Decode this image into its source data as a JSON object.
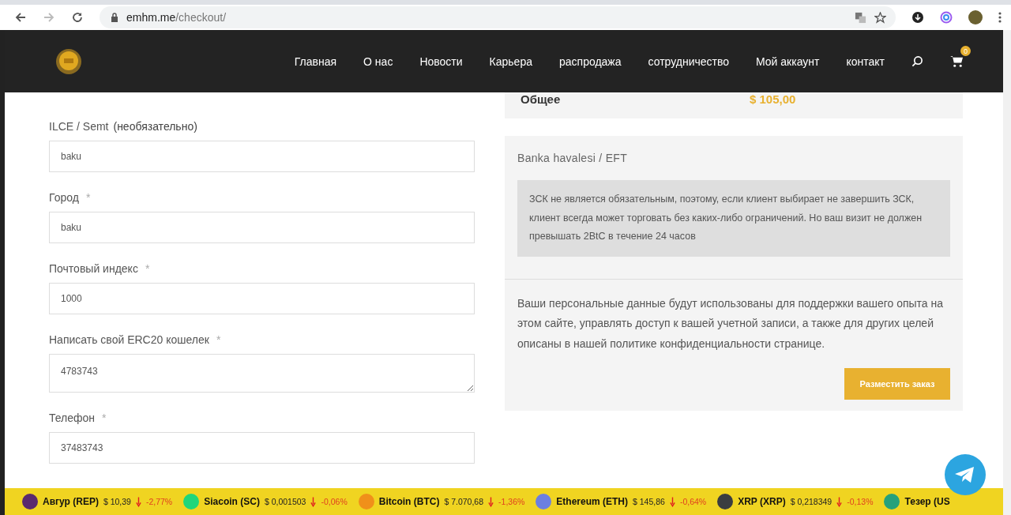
{
  "browser": {
    "url_host": "emhm.me",
    "url_path": "/checkout/"
  },
  "nav": {
    "items": [
      "Главная",
      "О нас",
      "Новости",
      "Карьера",
      "распродажа",
      "сотрудничество",
      "Мой аккаунт",
      "контакт"
    ],
    "cart_count": "0"
  },
  "form": {
    "fields": [
      {
        "label": "ILCE / Semt",
        "note": "(необязательно)",
        "value": "baku",
        "kind": "input"
      },
      {
        "label": "Город",
        "required_mark": "*",
        "value": "baku",
        "kind": "input"
      },
      {
        "label": "Почтовый индекс",
        "required_mark": "*",
        "value": "1000",
        "kind": "input"
      },
      {
        "label": "Написать свой ERC20 кошелек",
        "required_mark": "*",
        "value": "4783743",
        "kind": "textarea"
      },
      {
        "label": "Телефон",
        "required_mark": "*",
        "value": "37483743",
        "kind": "input"
      }
    ]
  },
  "totals": {
    "label": "Общее",
    "amount": "$ 105,00"
  },
  "payment": {
    "method": "Banka havalesi / EFT",
    "note": "ЗСК не является обязательным, поэтому, если клиент выбирает не завершить ЗСК, клиент всегда может торговать без каких-либо ограничений. Но ваш визит не должен превышать 2BtC в течение 24 часов",
    "privacy": "Ваши персональные данные будут использованы для поддержки вашего опыта на этом сайте, управлять доступ к вашей учетной записи, а также для других целей описаны в нашей политике конфиденциальности странице.",
    "button": "Разместить заказ"
  },
  "ticker": [
    {
      "name": "Авгур (REP)",
      "price": "$ 10,39",
      "change": "-2,77%",
      "down": true,
      "color": "#5a2a6e"
    },
    {
      "name": "Siacoin (SC)",
      "price": "$ 0,001503",
      "change": "-0,06%",
      "down": true,
      "color": "#20d67a"
    },
    {
      "name": "Bitcoin (BTC)",
      "price": "$ 7.070,68",
      "change": "-1,36%",
      "down": true,
      "color": "#f0901a"
    },
    {
      "name": "Ethereum (ETH)",
      "price": "$ 145,86",
      "change": "-0,64%",
      "down": true,
      "color": "#6c7fe0"
    },
    {
      "name": "XRP (XRP)",
      "price": "$ 0,218349",
      "change": "-0,13%",
      "down": true,
      "color": "#3a3d40"
    },
    {
      "name": "Тезер (US",
      "color": "#26a17b"
    }
  ]
}
